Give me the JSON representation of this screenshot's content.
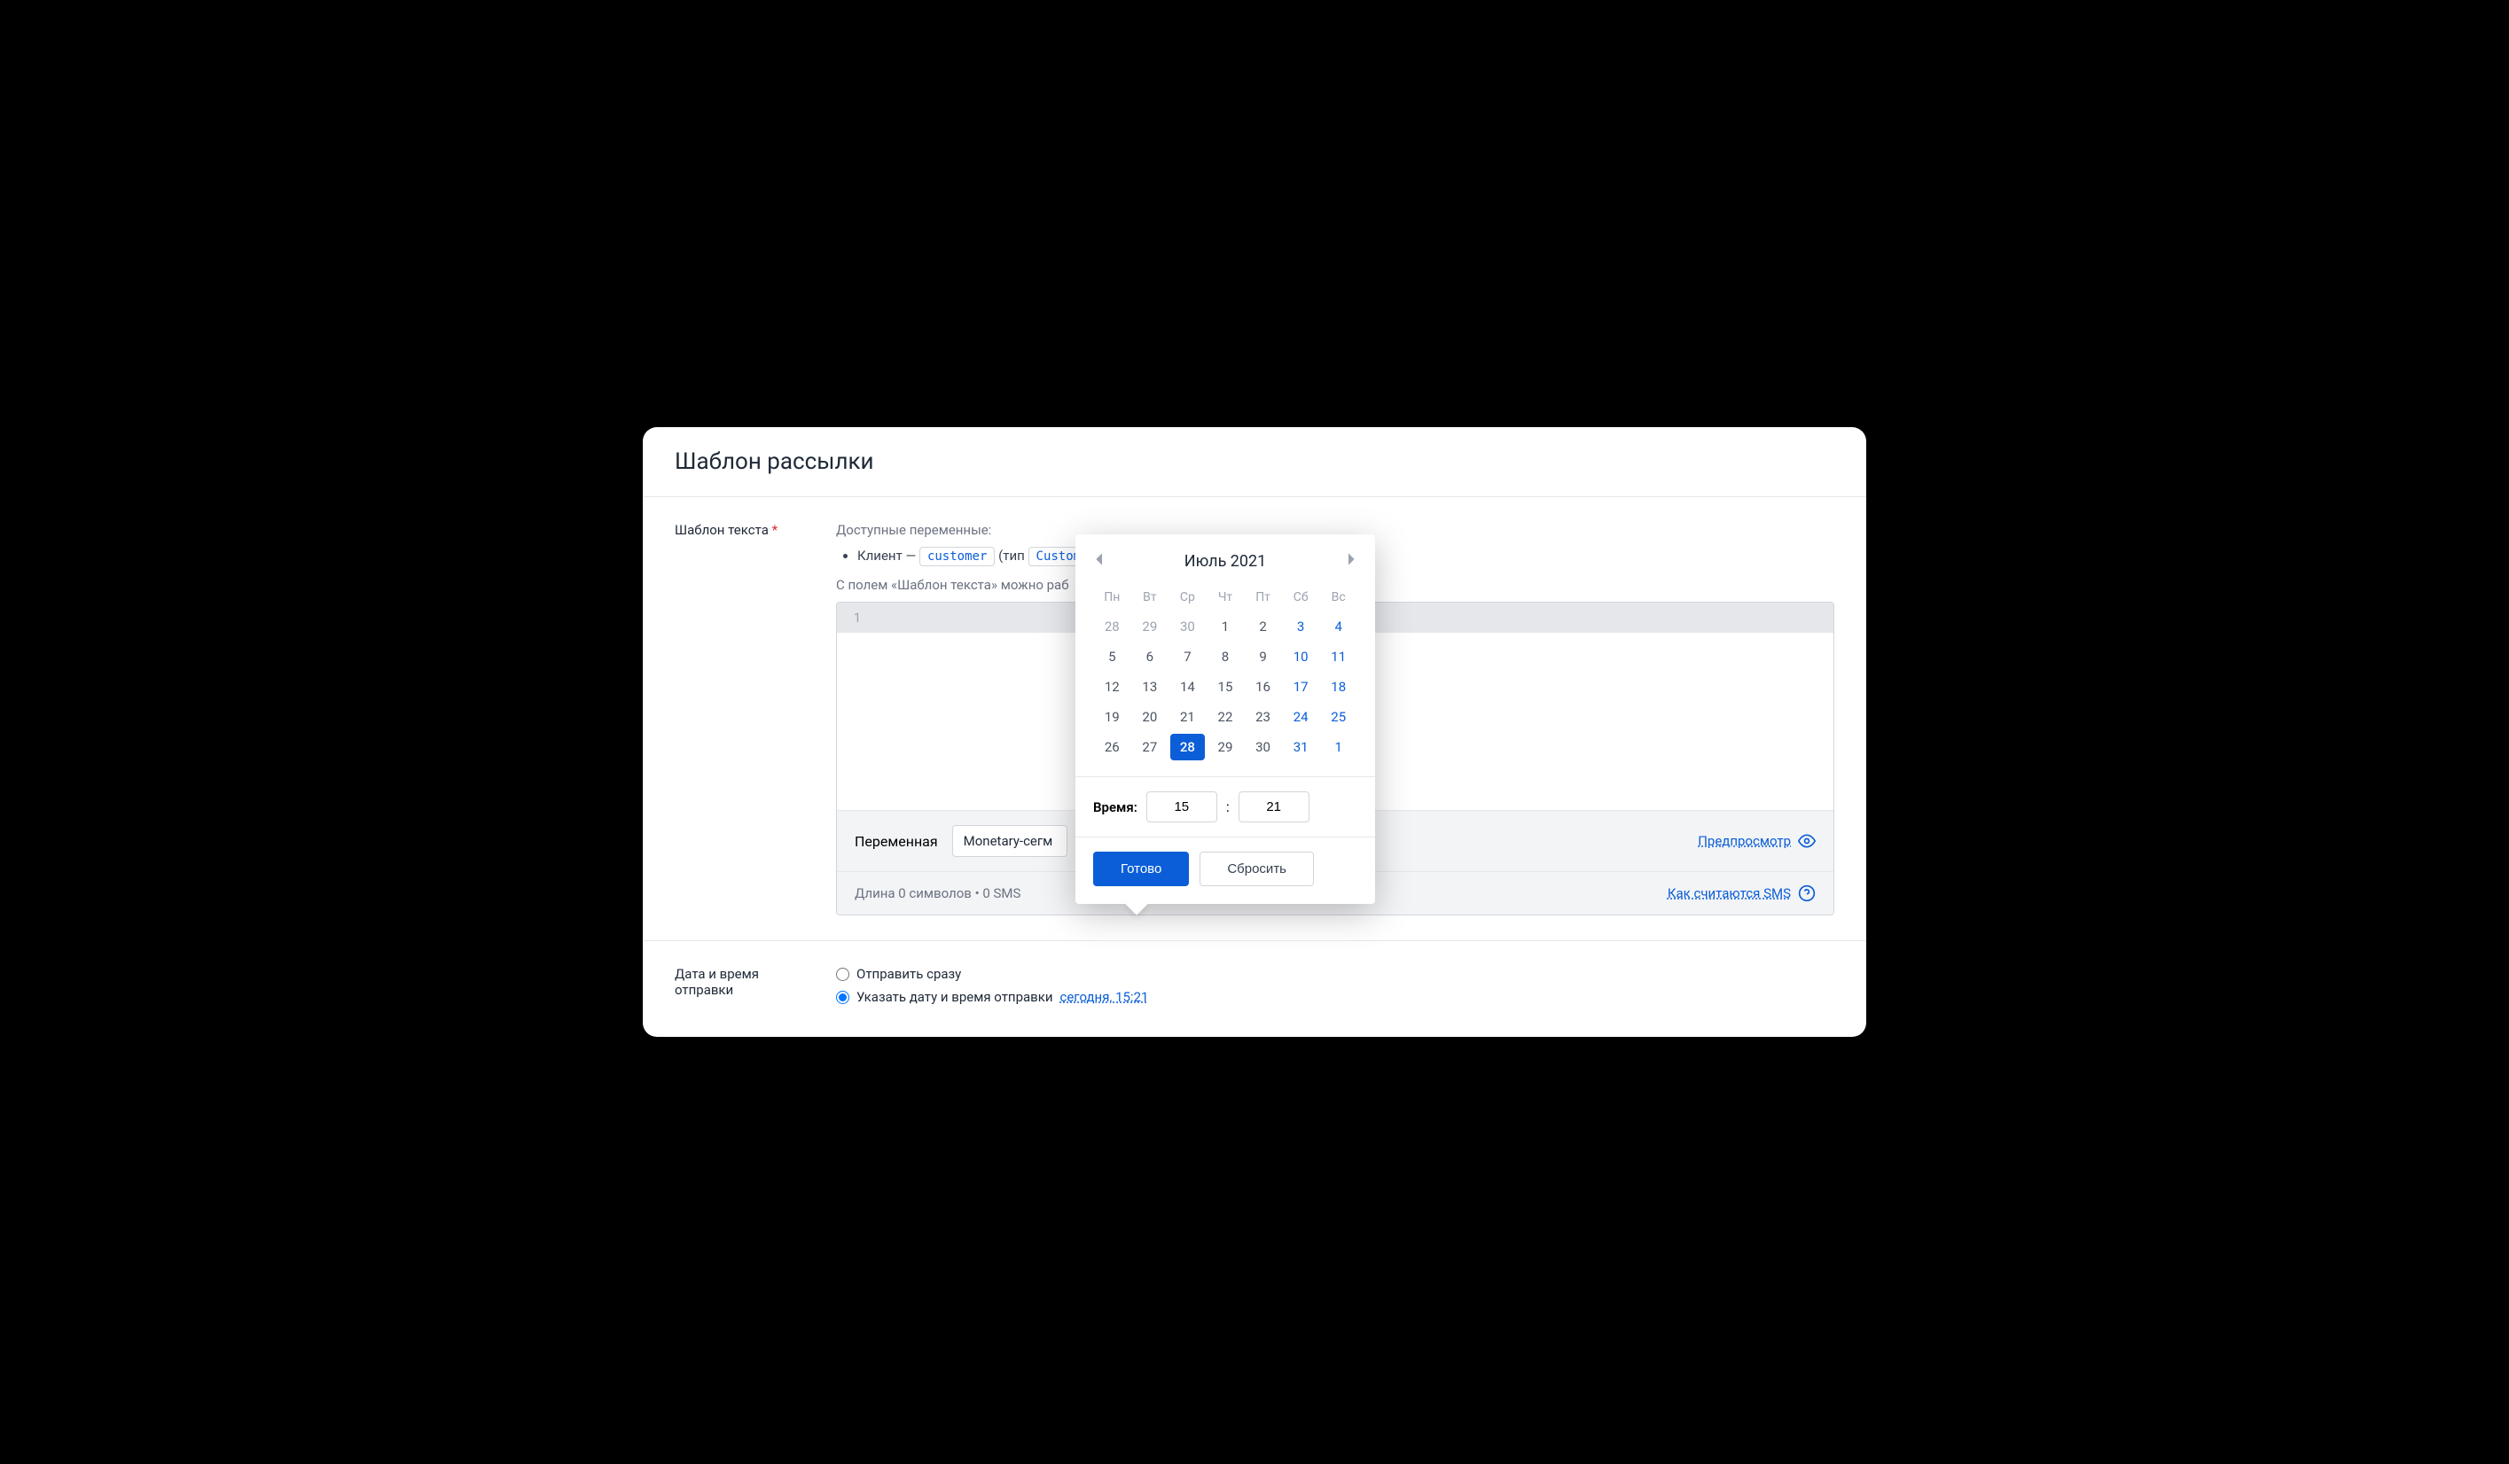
{
  "header": {
    "title": "Шаблон рассылки"
  },
  "template": {
    "label": "Шаблон текста",
    "vars_hint": "Доступные переменные:",
    "var_item_prefix": "Клиент — ",
    "var_name": "customer",
    "var_type_prefix": "(тип ",
    "var_type": "Customer",
    "var_type_suffix": ")",
    "field_hint": "С полем «Шаблон текста» можно раб",
    "line_number": "1",
    "variable_label": "Переменная",
    "variable_select": "Monetary-сегм",
    "preview_link": "Предпросмотр",
    "length_text": "Длина 0 символов • 0 SMS",
    "sms_help_link": "Как считаются SMS"
  },
  "schedule": {
    "label": "Дата и время отправки",
    "option_now": "Отправить сразу",
    "option_date": "Указать дату и время отправки",
    "date_value": "сегодня, 15:21"
  },
  "datepicker": {
    "month": "Июль 2021",
    "dow": [
      "Пн",
      "Вт",
      "Ср",
      "Чт",
      "Пт",
      "Сб",
      "Вс"
    ],
    "weeks": [
      [
        {
          "d": "28",
          "other": true
        },
        {
          "d": "29",
          "other": true
        },
        {
          "d": "30",
          "other": true
        },
        {
          "d": "1"
        },
        {
          "d": "2"
        },
        {
          "d": "3",
          "weekend": true
        },
        {
          "d": "4",
          "weekend": true
        }
      ],
      [
        {
          "d": "5"
        },
        {
          "d": "6"
        },
        {
          "d": "7"
        },
        {
          "d": "8"
        },
        {
          "d": "9"
        },
        {
          "d": "10",
          "weekend": true
        },
        {
          "d": "11",
          "weekend": true
        }
      ],
      [
        {
          "d": "12"
        },
        {
          "d": "13"
        },
        {
          "d": "14"
        },
        {
          "d": "15"
        },
        {
          "d": "16"
        },
        {
          "d": "17",
          "weekend": true
        },
        {
          "d": "18",
          "weekend": true
        }
      ],
      [
        {
          "d": "19"
        },
        {
          "d": "20"
        },
        {
          "d": "21"
        },
        {
          "d": "22"
        },
        {
          "d": "23"
        },
        {
          "d": "24",
          "weekend": true
        },
        {
          "d": "25",
          "weekend": true
        }
      ],
      [
        {
          "d": "26"
        },
        {
          "d": "27"
        },
        {
          "d": "28",
          "selected": true
        },
        {
          "d": "29"
        },
        {
          "d": "30"
        },
        {
          "d": "31",
          "weekend": true
        },
        {
          "d": "1",
          "weekend": true,
          "other": true
        }
      ]
    ],
    "time_label": "Время:",
    "hours": "15",
    "minutes": "21",
    "done_btn": "Готово",
    "reset_btn": "Сбросить"
  }
}
